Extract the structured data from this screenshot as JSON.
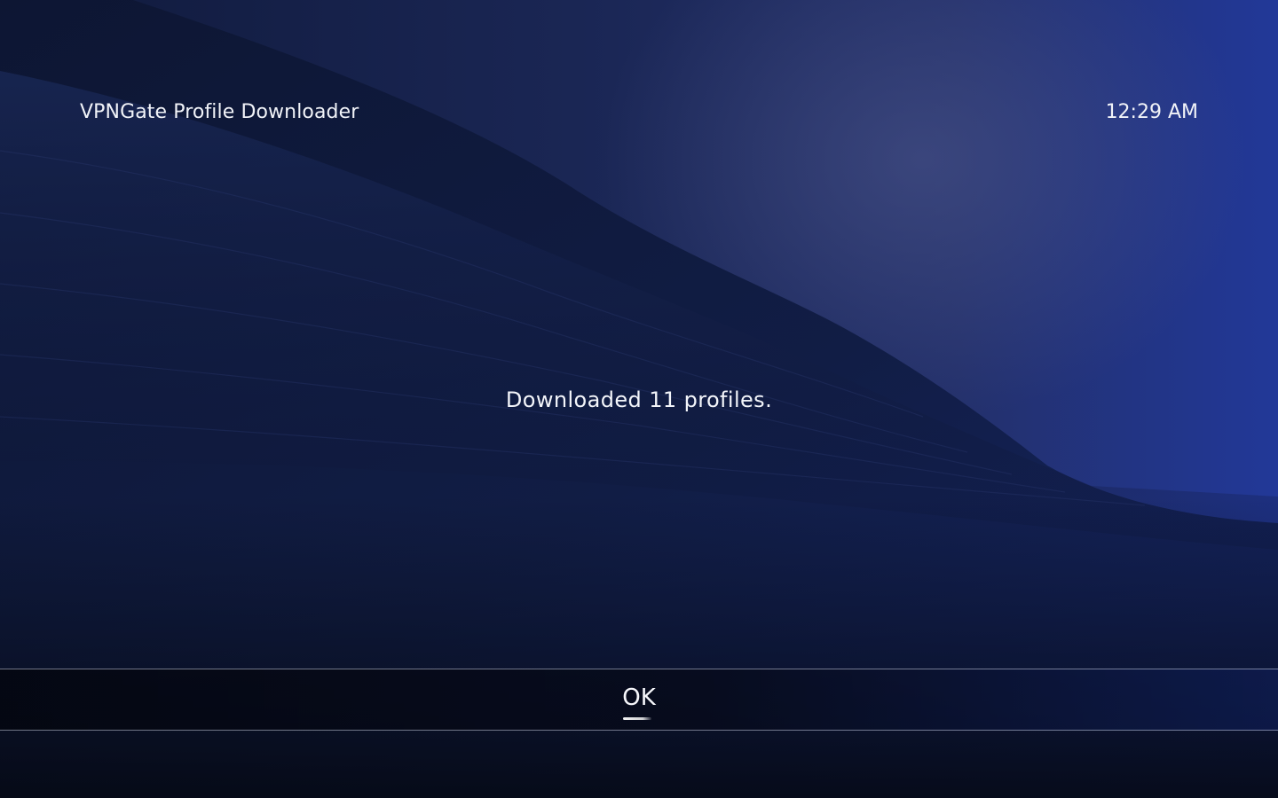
{
  "header": {
    "title": "VPNGate Profile Downloader",
    "clock": "12:29 AM"
  },
  "dialog": {
    "message": "Downloaded 11 profiles."
  },
  "buttons": {
    "ok_label": "OK"
  },
  "colors": {
    "background_dark": "#0b1430",
    "background_accent": "#223898",
    "text": "#eef0f6"
  }
}
